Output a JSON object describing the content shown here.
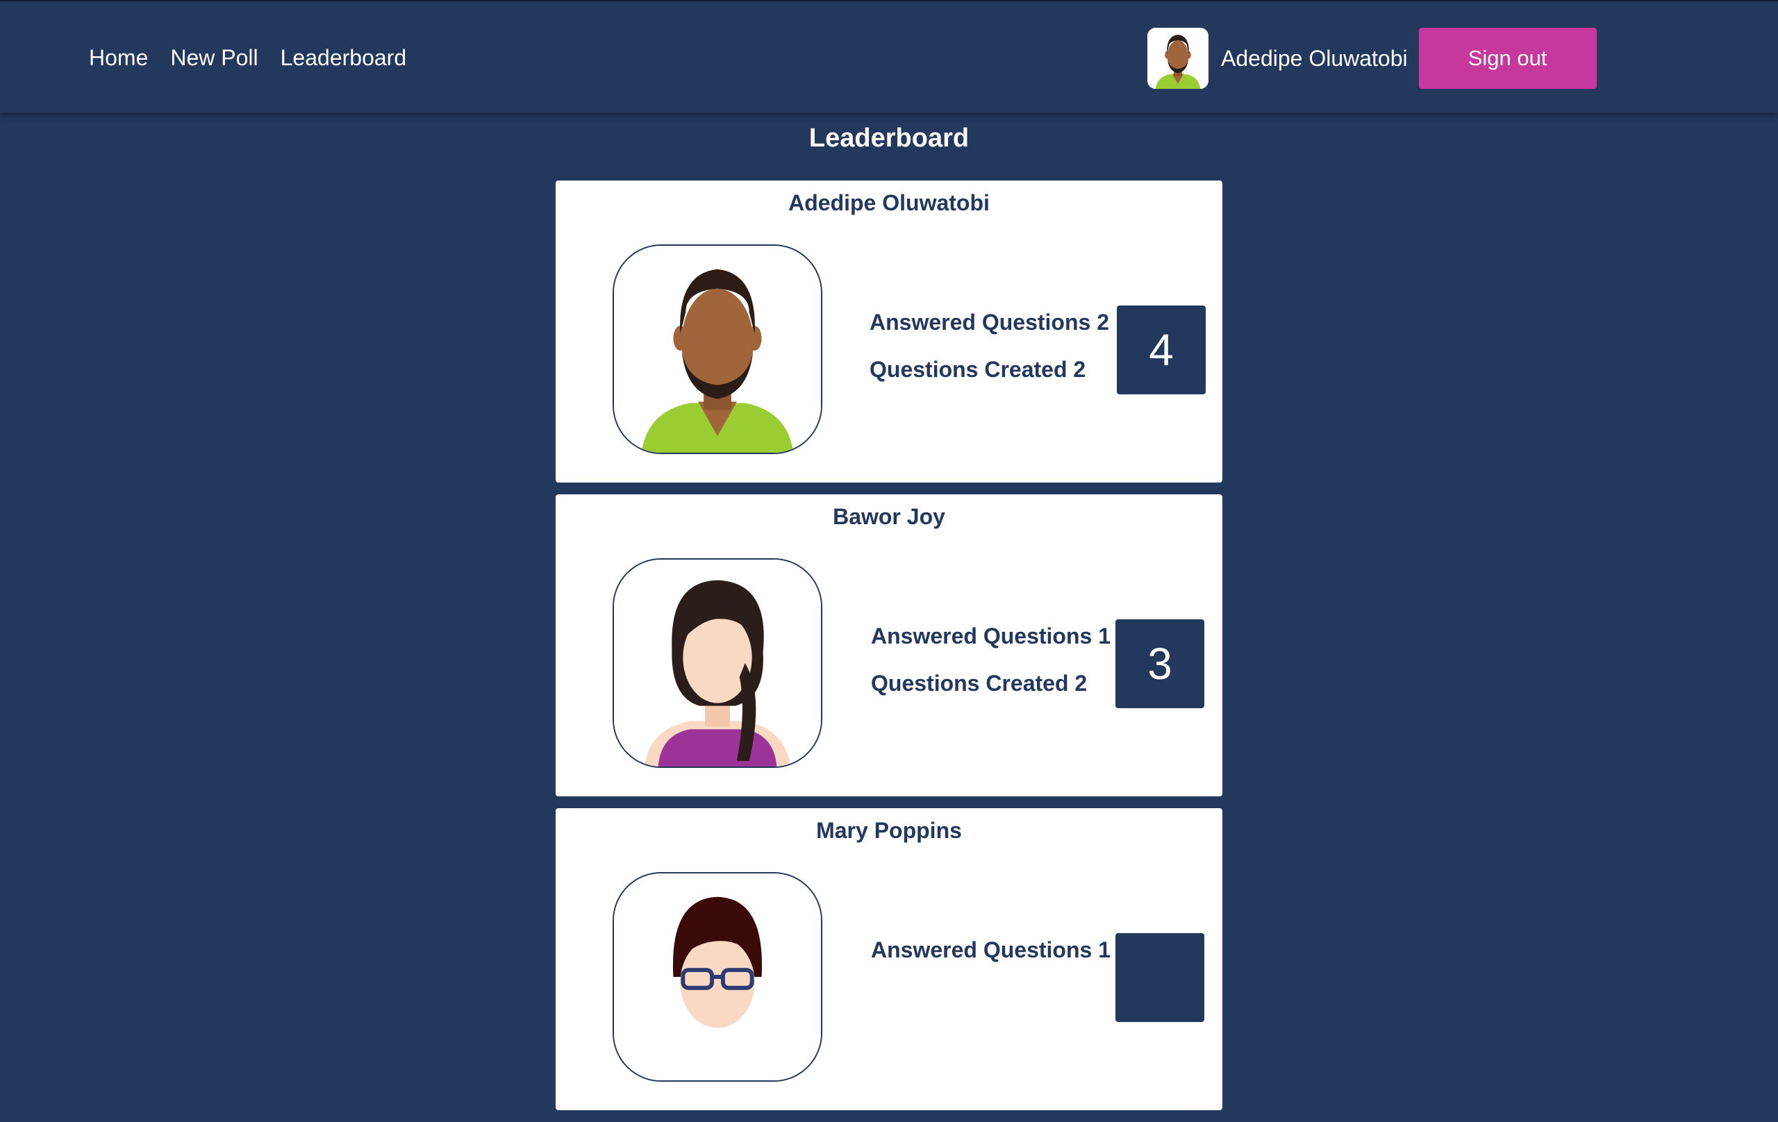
{
  "nav": {
    "items": [
      {
        "label": "Home"
      },
      {
        "label": "New Poll"
      },
      {
        "label": "Leaderboard"
      }
    ]
  },
  "user": {
    "name": "Adedipe Oluwatobi",
    "signout_label": "Sign out",
    "avatar_icon": "male-avatar-icon"
  },
  "page": {
    "title": "Leaderboard"
  },
  "leaderboard": [
    {
      "name": "Adedipe Oluwatobi",
      "answered_text": "Answered Questions 2",
      "created_text": "Questions Created 2",
      "score": "4",
      "avatar_icon": "male-avatar-icon"
    },
    {
      "name": "Bawor Joy",
      "answered_text": "Answered Questions 1",
      "created_text": "Questions Created 2",
      "score": "3",
      "avatar_icon": "female-avatar-icon"
    },
    {
      "name": "Mary Poppins",
      "answered_text": "Answered Questions 1",
      "created_text": "",
      "score": "",
      "avatar_icon": "female-glasses-avatar-icon"
    }
  ],
  "colors": {
    "background": "#22385c",
    "accent": "#c6389c",
    "card": "#ffffff"
  }
}
